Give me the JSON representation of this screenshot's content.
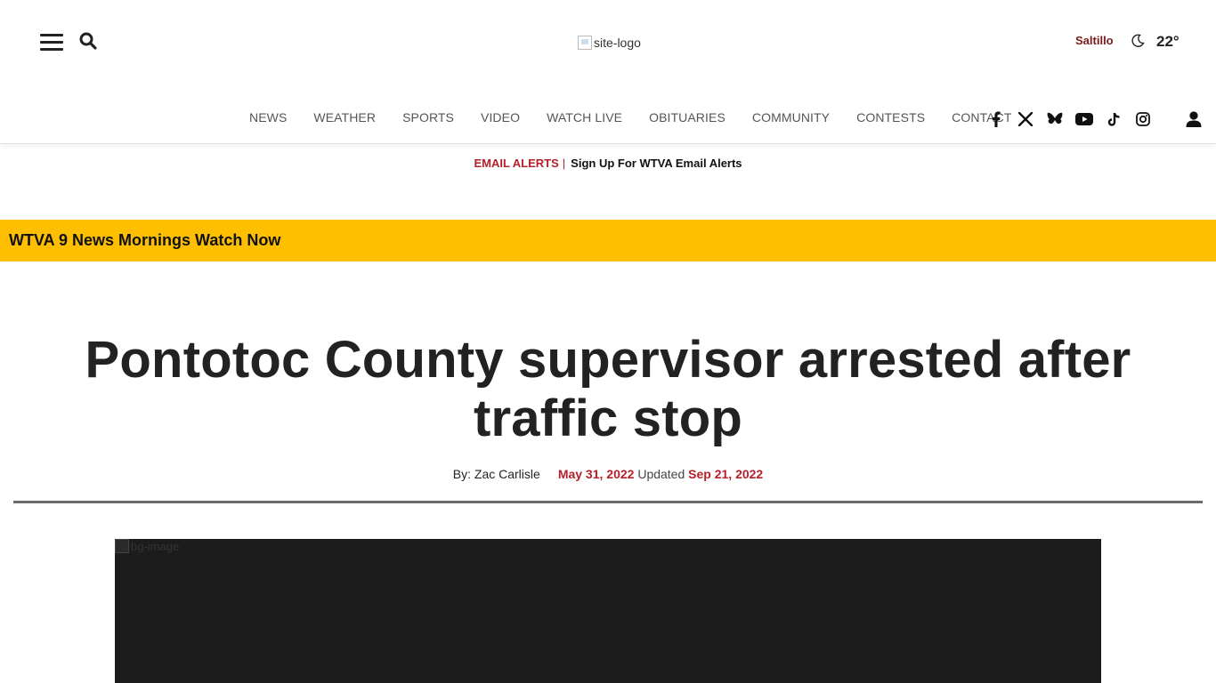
{
  "header": {
    "logo_alt": "site-logo",
    "city": "Saltillo",
    "temperature": "22°"
  },
  "nav": {
    "items": [
      {
        "label": "NEWS"
      },
      {
        "label": "WEATHER"
      },
      {
        "label": "SPORTS"
      },
      {
        "label": "VIDEO"
      },
      {
        "label": "WATCH LIVE"
      },
      {
        "label": "OBITUARIES"
      },
      {
        "label": "COMMUNITY"
      },
      {
        "label": "CONTESTS"
      },
      {
        "label": "CONTACT"
      }
    ],
    "socials": [
      {
        "icon": "facebook-icon"
      },
      {
        "icon": "x-icon"
      },
      {
        "icon": "bluesky-icon"
      },
      {
        "icon": "youtube-icon"
      },
      {
        "icon": "tiktok-icon"
      },
      {
        "icon": "instagram-icon"
      }
    ]
  },
  "alerts": {
    "label": "EMAIL ALERTS",
    "separator": "|",
    "message": "Sign Up For WTVA Email Alerts"
  },
  "banner": {
    "text": "WTVA 9 News Mornings Watch Now"
  },
  "article": {
    "title": "Pontotoc County supervisor arrested after traffic stop",
    "byline": "By: Zac Carlisle",
    "published": "May 31, 2022",
    "updated_label": "Updated",
    "updated": "Sep 21, 2022",
    "image_alt": "bg-image"
  },
  "colors": {
    "accent_red": "#b5202a",
    "banner_yellow": "#fdbf00",
    "city_color": "#7a1a1a"
  }
}
